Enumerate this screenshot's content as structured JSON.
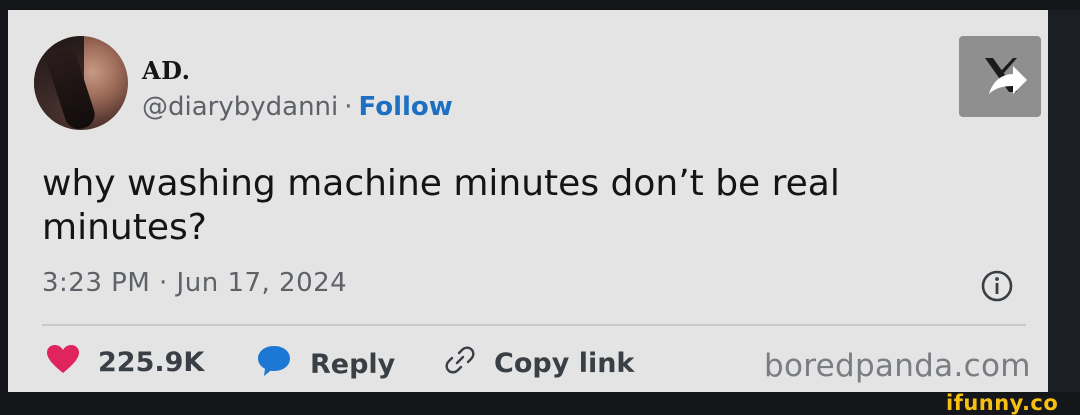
{
  "tweet": {
    "display_name": "AD.",
    "handle": "@diarybydanni",
    "separator": "·",
    "follow_label": "Follow",
    "text": "why washing machine minutes don’t be real minutes?",
    "timestamp": "3:23 PM · Jun 17, 2024"
  },
  "actions": {
    "likes_count": "225.9K",
    "reply_label": "Reply",
    "copy_link_label": "Copy link"
  },
  "icons": {
    "x_logo": "x-logo-share-icon",
    "info": "info-icon",
    "like": "heart-icon",
    "reply": "speech-bubble-icon",
    "link": "link-icon"
  },
  "watermarks": {
    "source": "boredpanda.com",
    "site": "ifunny.co"
  },
  "colors": {
    "card_background": "#e4e4e4",
    "follow_blue": "#1d6fc2",
    "like_pink": "#e0245e",
    "reply_blue": "#1d78d4",
    "ifunny_yellow": "#f6c012"
  }
}
